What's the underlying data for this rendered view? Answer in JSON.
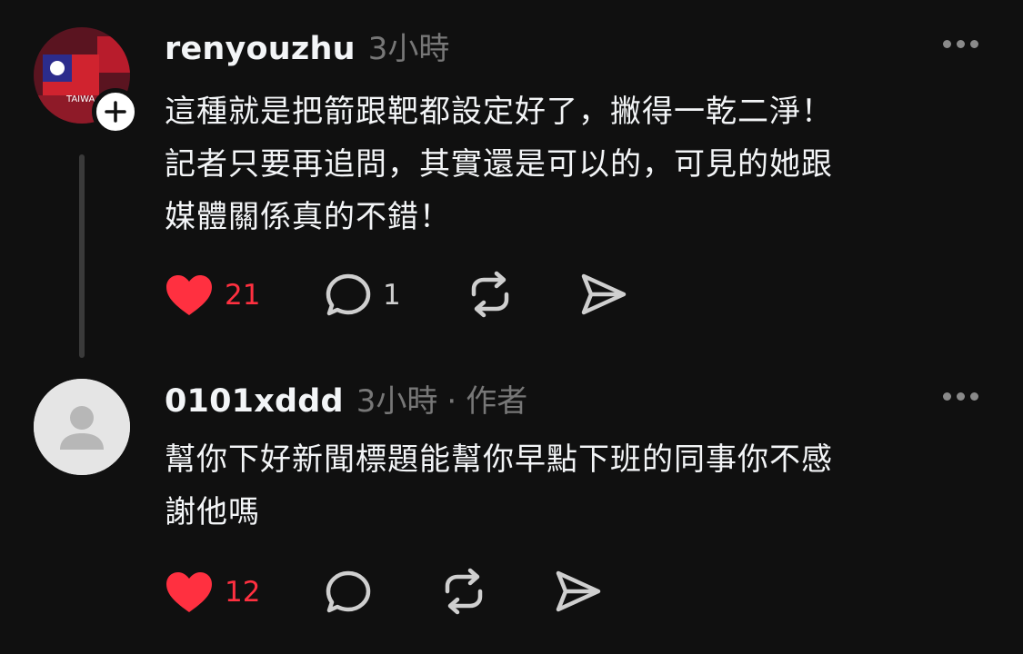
{
  "posts": [
    {
      "username": "renyouzhu",
      "time": "3小時",
      "author_tag": "",
      "avatar_text": "TAIWA",
      "text": "這種就是把箭跟靶都設定好了，撇得一乾二淨！\n記者只要再追問，其實還是可以的，可見的她跟\n媒體關係真的不錯！",
      "likes": "21",
      "replies": "1"
    },
    {
      "username": "0101xddd",
      "time": "3小時",
      "separator": "·",
      "author_tag": "作者",
      "text": "幫你下好新聞標題能幫你早點下班的同事你不感\n謝他嗎",
      "likes": "12",
      "replies": ""
    }
  ],
  "colors": {
    "background": "#101010",
    "like_red": "#ff3040",
    "muted": "#777777",
    "icon_gray": "#cfcfcf"
  },
  "icons": [
    "more-icon",
    "heart-icon",
    "reply-icon",
    "repost-icon",
    "share-icon",
    "plus-icon",
    "default-avatar-icon"
  ]
}
